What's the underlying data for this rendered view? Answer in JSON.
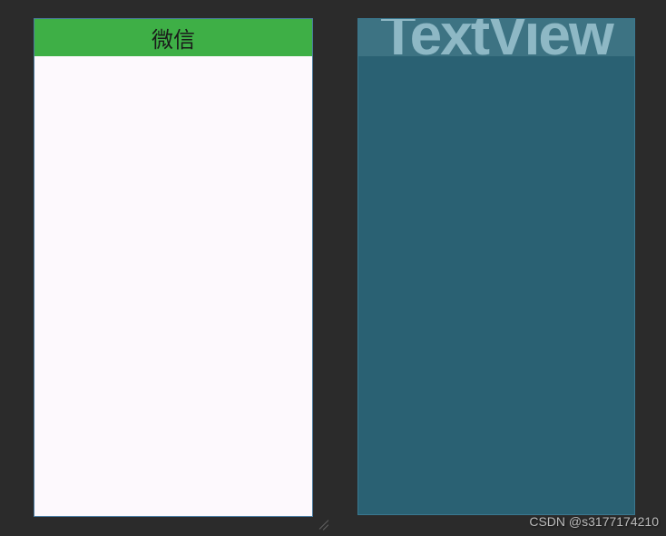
{
  "left_device": {
    "header_title": "微信"
  },
  "right_device": {
    "blueprint_label": "TextView"
  },
  "watermark": "CSDN @s3177174210"
}
